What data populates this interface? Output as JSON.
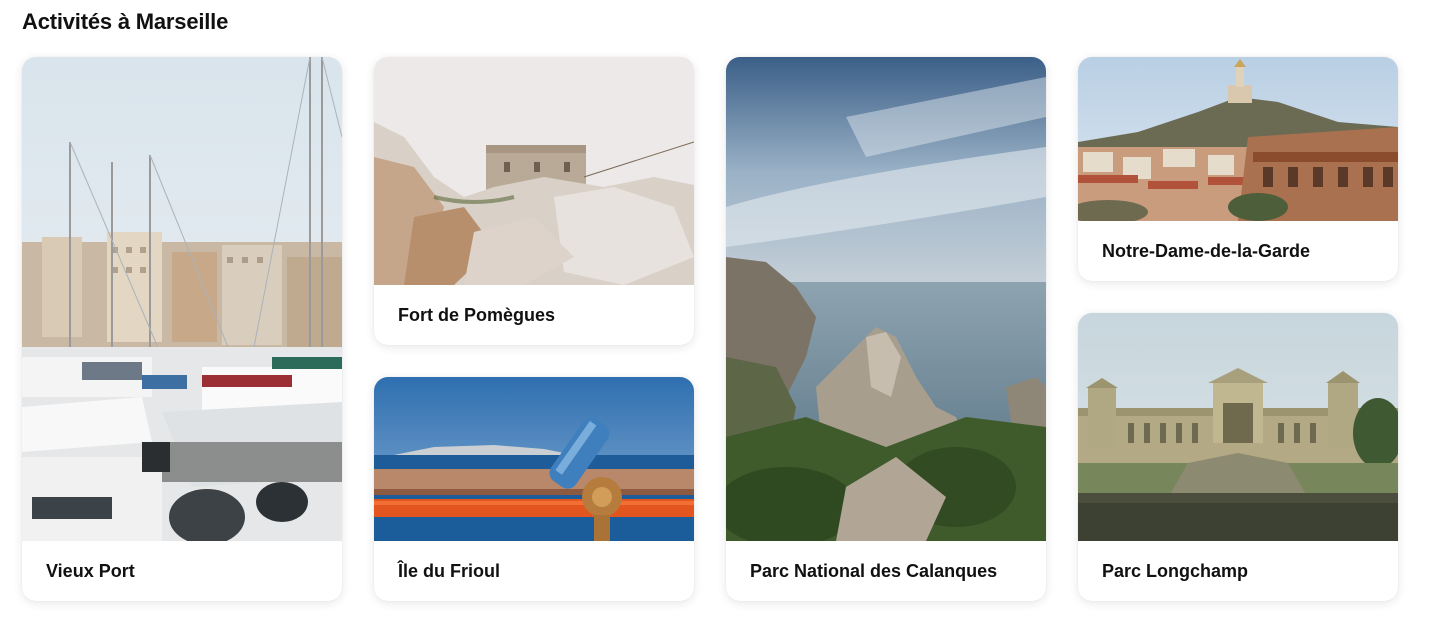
{
  "page": {
    "title": "Activités à Marseille"
  },
  "cards": [
    {
      "label": "Vieux Port",
      "image": "harbor-sailboats-photo"
    },
    {
      "label": "Fort de Pomègues",
      "image": "fort-on-rocks-photo"
    },
    {
      "label": "Île du Frioul",
      "image": "island-binoculars-photo"
    },
    {
      "label": "Parc National des Calanques",
      "image": "cliffs-sea-photo"
    },
    {
      "label": "Notre-Dame-de-la-Garde",
      "image": "basilica-hill-city-photo"
    },
    {
      "label": "Parc Longchamp",
      "image": "palace-fountain-photo"
    }
  ]
}
